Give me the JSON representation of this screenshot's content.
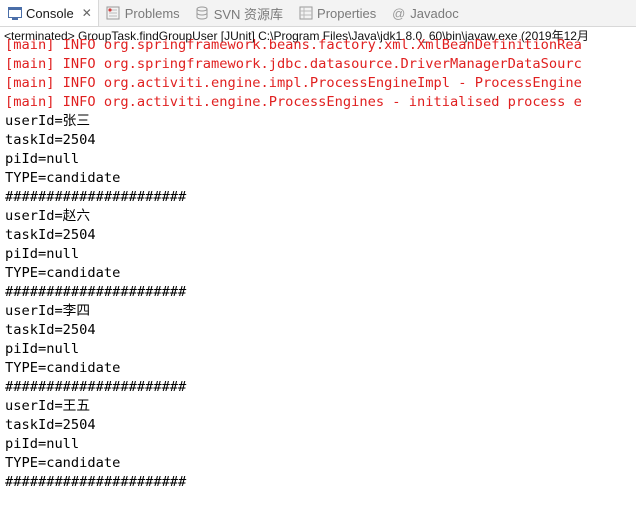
{
  "tabs": [
    {
      "label": "Console",
      "icon": "console-icon",
      "active": true,
      "close": "✕"
    },
    {
      "label": "Problems",
      "icon": "problems-icon"
    },
    {
      "label": "SVN 资源库",
      "icon": "svn-repository-icon"
    },
    {
      "label": "Properties",
      "icon": "properties-icon"
    },
    {
      "label": "Javadoc",
      "icon": "javadoc-icon"
    }
  ],
  "info_line": "<terminated> GroupTask.findGroupUser [JUnit] C:\\Program Files\\Java\\jdk1.8.0_60\\bin\\javaw.exe (2019年12月",
  "colors": {
    "error_text": "#e02020",
    "normal_text": "#000000"
  },
  "console_lines": [
    {
      "text": "[main] INFO org.springframework.beans.factory.xml.XmlBeanDefinitionRea",
      "type": "err"
    },
    {
      "text": "[main] INFO org.springframework.jdbc.datasource.DriverManagerDataSourc",
      "type": "err"
    },
    {
      "text": "[main] INFO org.activiti.engine.impl.ProcessEngineImpl - ProcessEngine",
      "type": "err"
    },
    {
      "text": "[main] INFO org.activiti.engine.ProcessEngines - initialised process e",
      "type": "err"
    },
    {
      "text": "userId=张三",
      "type": "out"
    },
    {
      "text": "taskId=2504",
      "type": "out"
    },
    {
      "text": "piId=null",
      "type": "out"
    },
    {
      "text": "TYPE=candidate",
      "type": "out"
    },
    {
      "text": "######################",
      "type": "out"
    },
    {
      "text": "userId=赵六",
      "type": "out"
    },
    {
      "text": "taskId=2504",
      "type": "out"
    },
    {
      "text": "piId=null",
      "type": "out"
    },
    {
      "text": "TYPE=candidate",
      "type": "out"
    },
    {
      "text": "######################",
      "type": "out"
    },
    {
      "text": "userId=李四",
      "type": "out"
    },
    {
      "text": "taskId=2504",
      "type": "out"
    },
    {
      "text": "piId=null",
      "type": "out"
    },
    {
      "text": "TYPE=candidate",
      "type": "out"
    },
    {
      "text": "######################",
      "type": "out"
    },
    {
      "text": "userId=王五",
      "type": "out"
    },
    {
      "text": "taskId=2504",
      "type": "out"
    },
    {
      "text": "piId=null",
      "type": "out"
    },
    {
      "text": "TYPE=candidate",
      "type": "out"
    },
    {
      "text": "######################",
      "type": "out"
    }
  ]
}
